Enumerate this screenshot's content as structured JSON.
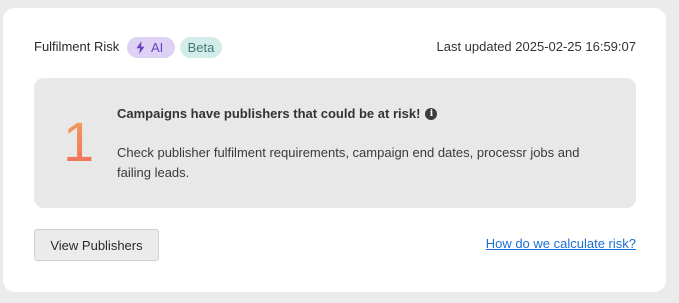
{
  "card": {
    "title": "Fulfilment Risk",
    "badges": {
      "ai_label": "AI",
      "beta_label": "Beta"
    },
    "last_updated": "Last updated 2025-02-25 16:59:07"
  },
  "alert": {
    "count": "1",
    "heading": "Campaigns have publishers that could be at risk!",
    "body": "Check publisher fulfilment requirements, campaign end dates, processr jobs and failing leads."
  },
  "actions": {
    "view_publishers_label": "View Publishers",
    "calculate_risk_link": "How do we calculate risk?"
  },
  "colors": {
    "ai_badge_bg": "#ddd2f4",
    "ai_badge_text": "#6a3fc4",
    "beta_badge_bg": "#d3ecea",
    "beta_badge_text": "#3f7874",
    "count_gradient_top": "#f4a35d",
    "count_gradient_bottom": "#ef6a5a",
    "link": "#1a6fd4"
  },
  "icons": {
    "ai_badge": "lightning-bolt-icon",
    "heading_info": "info-icon"
  }
}
